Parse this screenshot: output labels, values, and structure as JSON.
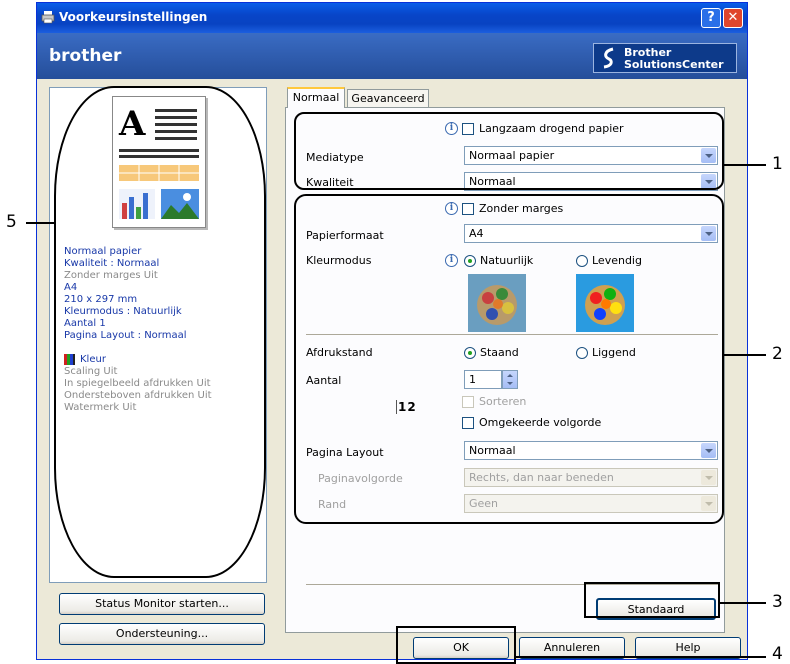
{
  "window": {
    "title": "Voorkeursinstellingen",
    "help_glyph": "?",
    "close_glyph": "✕"
  },
  "brand": {
    "logo": "brother",
    "solutions_line1": "Brother",
    "solutions_line2": "SolutionsCenter"
  },
  "preview": {
    "letter": "A"
  },
  "summary": {
    "lines": [
      {
        "text": "Normaal papier",
        "active": true
      },
      {
        "text": "Kwaliteit : Normaal",
        "active": true
      },
      {
        "text": "Zonder marges Uit",
        "active": false
      },
      {
        "text": "A4",
        "active": true
      },
      {
        "text": "210 x 297 mm",
        "active": true
      },
      {
        "text": "Kleurmodus : Natuurlijk",
        "active": true
      },
      {
        "text": "Aantal 1",
        "active": true
      },
      {
        "text": "Pagina Layout : Normaal",
        "active": true
      }
    ],
    "color_label": "Kleur",
    "lines2": [
      {
        "text": "Scaling Uit"
      },
      {
        "text": "In spiegelbeeld afdrukken Uit"
      },
      {
        "text": "Ondersteboven afdrukken Uit"
      },
      {
        "text": "Watermerk Uit"
      }
    ]
  },
  "buttons": {
    "status_monitor": "Status Monitor starten...",
    "support": "Ondersteuning...",
    "default": "Standaard",
    "ok": "OK",
    "cancel": "Annuleren",
    "help": "Help"
  },
  "tabs": {
    "normal": "Normaal",
    "advanced": "Geavanceerd"
  },
  "form": {
    "slow_dry": "Langzaam drogend papier",
    "media_label": "Mediatype",
    "media_value": "Normaal papier",
    "quality_label": "Kwaliteit",
    "quality_value": "Normaal",
    "borderless": "Zonder marges",
    "paper_label": "Papierformaat",
    "paper_value": "A4",
    "colormode_label": "Kleurmodus",
    "natural": "Natuurlijk",
    "vivid": "Levendig",
    "orientation_label": "Afdrukstand",
    "portrait": "Staand",
    "landscape": "Liggend",
    "copies_label": "Aantal",
    "copies_value": "1",
    "collate": "Sorteren",
    "reverse": "Omgekeerde volgorde",
    "layout_label": "Pagina Layout",
    "layout_value": "Normaal",
    "order_label": "Paginavolgorde",
    "order_value": "Rechts, dan naar beneden",
    "border_label": "Rand",
    "border_value": "Geen",
    "collate_icon": "12"
  },
  "callouts": {
    "c1": "1",
    "c2": "2",
    "c3": "3",
    "c4": "4",
    "c5": "5"
  }
}
